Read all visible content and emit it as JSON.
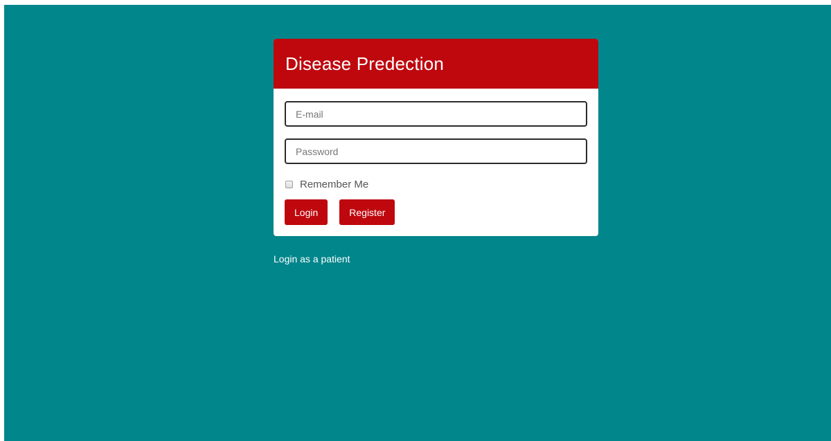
{
  "colors": {
    "background": "#00868b",
    "accent": "#be080e",
    "panel": "#ffffff"
  },
  "panel": {
    "title": "Disease Predection"
  },
  "form": {
    "email": {
      "placeholder": "E-mail",
      "value": ""
    },
    "password": {
      "placeholder": "Password",
      "value": ""
    },
    "remember": {
      "label": "Remember Me",
      "checked": false
    },
    "login_label": "Login",
    "register_label": "Register"
  },
  "footer": {
    "patient_link": "Login as a patient"
  }
}
